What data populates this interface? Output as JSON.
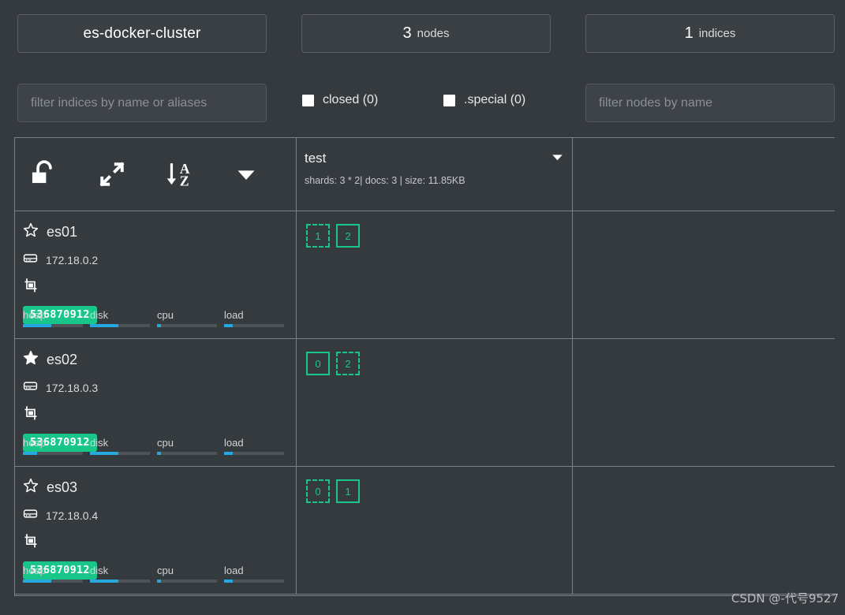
{
  "app": {
    "background": "#353a3f",
    "accent_green": "#19c68a",
    "accent_blue": "#27a6e0",
    "border": "#7a8085"
  },
  "summary": {
    "cluster": {
      "name": "es-docker-cluster"
    },
    "nodes": {
      "count": "3",
      "label": "nodes"
    },
    "indices": {
      "count": "1",
      "label": "indices"
    }
  },
  "filters": {
    "indices_placeholder": "filter indices by name or aliases",
    "indices_value": "",
    "nodes_placeholder": "filter nodes by name",
    "nodes_value": "",
    "closed": {
      "label": "closed (0)",
      "checked": false,
      "icon": "checkbox-icon"
    },
    "special": {
      "label": ".special (0)",
      "checked": false,
      "icon": "checkbox-icon"
    }
  },
  "toolbar": {
    "items": [
      {
        "name": "unlock-icon",
        "title": "unlock"
      },
      {
        "name": "expand-icon",
        "title": "expand"
      },
      {
        "name": "sort-az-icon",
        "title": "sort A-Z"
      },
      {
        "name": "caret-down-icon",
        "title": "more"
      }
    ]
  },
  "index_header": {
    "name": "test",
    "meta": "shards: 3 * 2| docs: 3 | size: 11.85KB",
    "caret": "caret-down-icon"
  },
  "nodes": [
    {
      "name": "es01",
      "ip": "172.18.0.2",
      "star": "star-outline-icon",
      "master": false,
      "server_icon": "server-icon",
      "crop_icon": "crop-icon",
      "badge": "536870912",
      "metrics": [
        {
          "label": "heap",
          "pct": 48
        },
        {
          "label": "disk",
          "pct": 47
        },
        {
          "label": "cpu",
          "pct": 7
        },
        {
          "label": "load",
          "pct": 14
        }
      ],
      "shards": [
        {
          "value": "1",
          "type": "replica"
        },
        {
          "value": "2",
          "type": "primary"
        }
      ]
    },
    {
      "name": "es02",
      "ip": "172.18.0.3",
      "star": "star-filled-icon",
      "master": true,
      "server_icon": "server-icon",
      "crop_icon": "crop-icon",
      "badge": "536870912",
      "metrics": [
        {
          "label": "heap",
          "pct": 24
        },
        {
          "label": "disk",
          "pct": 47
        },
        {
          "label": "cpu",
          "pct": 7
        },
        {
          "label": "load",
          "pct": 14
        }
      ],
      "shards": [
        {
          "value": "0",
          "type": "primary"
        },
        {
          "value": "2",
          "type": "replica"
        }
      ]
    },
    {
      "name": "es03",
      "ip": "172.18.0.4",
      "star": "star-outline-icon",
      "master": false,
      "server_icon": "server-icon",
      "crop_icon": "crop-icon",
      "badge": "536870912",
      "metrics": [
        {
          "label": "heap",
          "pct": 48
        },
        {
          "label": "disk",
          "pct": 47
        },
        {
          "label": "cpu",
          "pct": 7
        },
        {
          "label": "load",
          "pct": 14
        }
      ],
      "shards": [
        {
          "value": "0",
          "type": "replica"
        },
        {
          "value": "1",
          "type": "primary"
        }
      ]
    }
  ],
  "watermark": {
    "text": "CSDN @-代号9527"
  }
}
